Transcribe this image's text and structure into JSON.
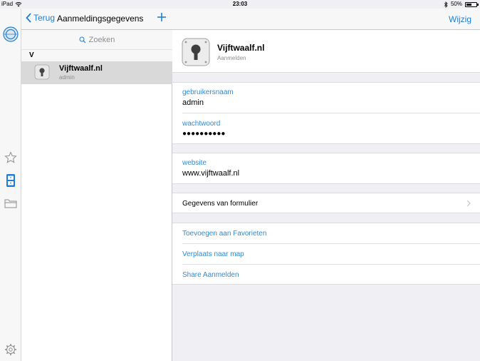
{
  "status_bar": {
    "device": "iPad",
    "time": "23:03",
    "battery_percent_label": "50%",
    "battery_level": 0.5
  },
  "sidebar_rail": {
    "icons": [
      "compass-icon",
      "star-icon",
      "cabinet-icon",
      "folder-icon",
      "settings-icon"
    ]
  },
  "list_pane": {
    "back_label": "Terug",
    "title": "Aanmeldingsgegevens",
    "search_placeholder": "Zoeken",
    "section_letter": "V",
    "items": [
      {
        "title": "Vijftwaalf.nl",
        "subtitle": "admin"
      }
    ]
  },
  "detail_pane": {
    "edit_label": "Wijzig",
    "item_title": "Vijftwaalf.nl",
    "item_category": "Aanmelden",
    "fields": {
      "username_label": "gebruikersnaam",
      "username_value": "admin",
      "password_label": "wachtwoord",
      "password_value": "●●●●●●●●●●",
      "website_label": "website",
      "website_value": "www.vijftwaalf.nl"
    },
    "form_details_label": "Gegevens van formulier",
    "actions": [
      "Toevoegen aan Favorieten",
      "Verplaats naar map",
      "Share Aanmelden"
    ]
  },
  "colors": {
    "accent": "#1f7fd6",
    "label_blue": "#2f8bd3",
    "selected_row": "#d9d9d9",
    "background": "#efeff4"
  }
}
